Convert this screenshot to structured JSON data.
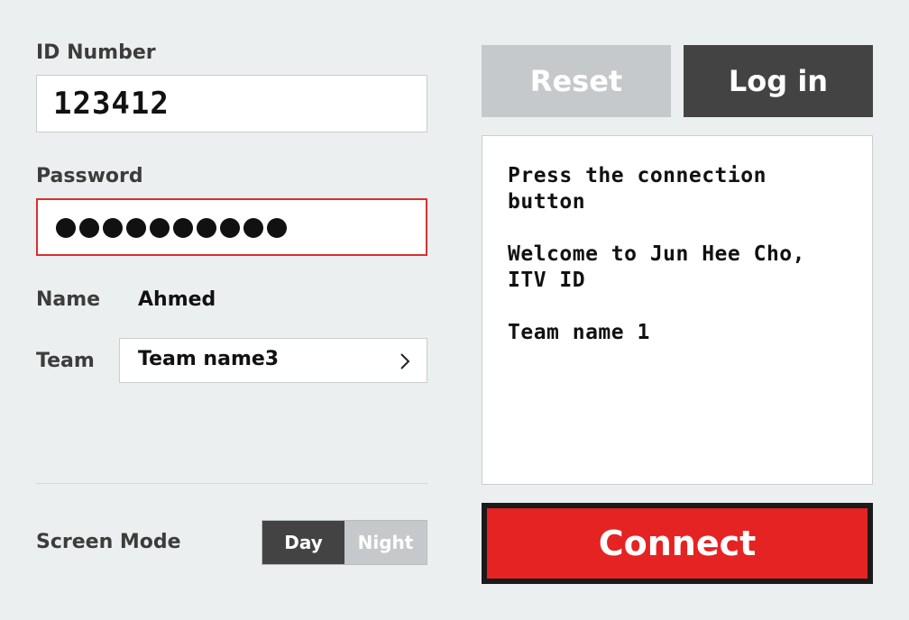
{
  "login_form": {
    "id_label": "ID Number",
    "id_value": "123412",
    "password_label": "Password",
    "password_length": 10,
    "name_label": "Name",
    "name_value": "Ahmed",
    "team_label": "Team",
    "team_value": "Team name3"
  },
  "screen_mode": {
    "label": "Screen Mode",
    "options": [
      "Day",
      "Night"
    ],
    "selected": "Day"
  },
  "actions": {
    "reset_label": "Reset",
    "login_label": "Log in",
    "connect_label": "Connect"
  },
  "messages": [
    "Press the connection button",
    "Welcome to Jun Hee Cho,\nITV ID",
    "Team name 1"
  ],
  "colors": {
    "background": "#eceff0",
    "accent_red": "#e52323",
    "dark": "#434343",
    "muted": "#c5c9cb",
    "password_border": "#d9302f"
  },
  "icons": {
    "team_chevron": "chevron-right-icon"
  }
}
